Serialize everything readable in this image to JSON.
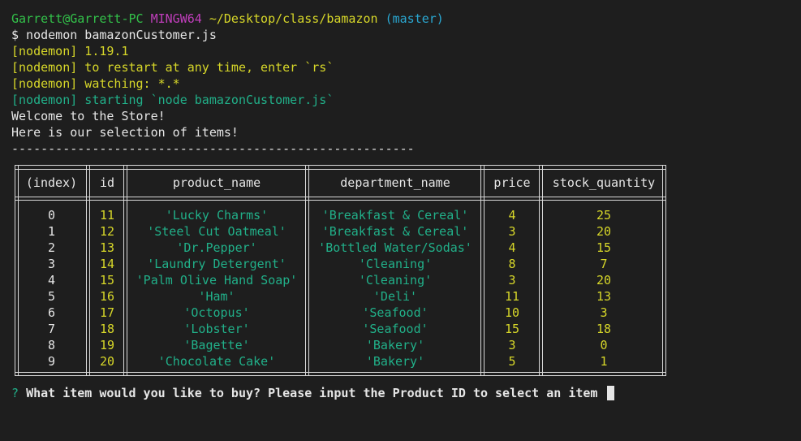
{
  "session": {
    "user_host": "Garrett@Garrett-PC",
    "shell": "MINGW64",
    "cwd": "~/Desktop/class/bamazon",
    "branch": "(master)",
    "command": "$ nodemon bamazonCustomer.js"
  },
  "log": [
    {
      "text": "[nodemon] 1.19.1",
      "color": "yellow"
    },
    {
      "text": "[nodemon] to restart at any time, enter `rs`",
      "color": "yellow"
    },
    {
      "text": "[nodemon] watching: *.*",
      "color": "yellow"
    },
    {
      "text": "[nodemon] starting `node bamazonCustomer.js`",
      "color": "teal"
    },
    {
      "text": "Welcome to the Store!",
      "color": "white"
    },
    {
      "text": "Here is our selection of items!",
      "color": "white"
    },
    {
      "text": "-------------------------------------------------------",
      "color": "white"
    }
  ],
  "table": {
    "headers": [
      "(index)",
      "id",
      "product_name",
      "department_name",
      "price",
      "stock_quantity"
    ],
    "rows": [
      [
        "0",
        "11",
        "'Lucky Charms'",
        "'Breakfast & Cereal'",
        "4",
        "25"
      ],
      [
        "1",
        "12",
        "'Steel Cut Oatmeal'",
        "'Breakfast & Cereal'",
        "3",
        "20"
      ],
      [
        "2",
        "13",
        "'Dr.Pepper'",
        "'Bottled Water/Sodas'",
        "4",
        "15"
      ],
      [
        "3",
        "14",
        "'Laundry Detergent'",
        "'Cleaning'",
        "8",
        "7"
      ],
      [
        "4",
        "15",
        "'Palm Olive Hand Soap'",
        "'Cleaning'",
        "3",
        "20"
      ],
      [
        "5",
        "16",
        "'Ham'",
        "'Deli'",
        "11",
        "13"
      ],
      [
        "6",
        "17",
        "'Octopus'",
        "'Seafood'",
        "10",
        "3"
      ],
      [
        "7",
        "18",
        "'Lobster'",
        "'Seafood'",
        "15",
        "18"
      ],
      [
        "8",
        "19",
        "'Bagette'",
        "'Bakery'",
        "3",
        "0"
      ],
      [
        "9",
        "20",
        "'Chocolate Cake'",
        "'Bakery'",
        "5",
        "1"
      ]
    ]
  },
  "prompt": {
    "mark": "?",
    "question": "What item would you like to buy? Please input the Product ID to select an item"
  },
  "colors": {
    "background": "#1e1e1e",
    "green": "#33c24a",
    "magenta": "#c13ebc",
    "yellow": "#d7d729",
    "cyan": "#2aa7d1",
    "teal": "#21b089"
  }
}
